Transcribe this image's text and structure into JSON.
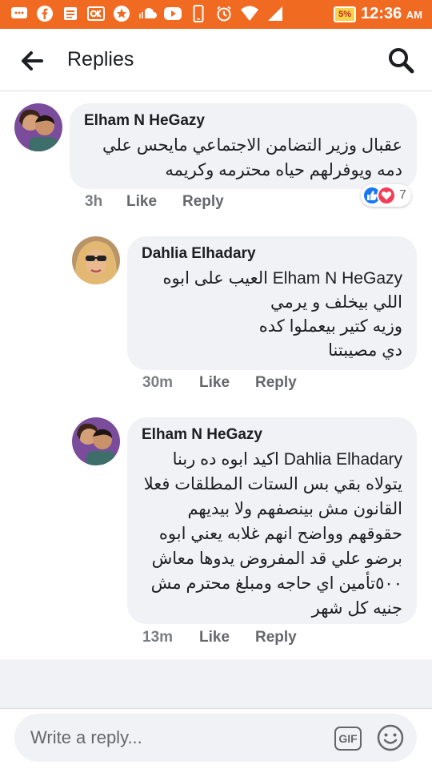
{
  "status_bar": {
    "battery": "5%",
    "time": "12:36",
    "am_pm": "AM"
  },
  "header": {
    "title": "Replies"
  },
  "comments": [
    {
      "author": "Elham N HeGazy",
      "lines": [
        "عقبال وزير التضامن الاجتماعي مايحس علي",
        "دمه ويوفرلهم حياه محترمه وكريمه"
      ],
      "time": "3h",
      "like": "Like",
      "reply": "Reply",
      "reaction_count": "7"
    },
    {
      "author": "Dahlia Elhadary",
      "lines": [
        "Elham N HeGazy العيب على ابوه",
        "اللي بيخلف و يرمي",
        "وزيه كتير بيعملوا كده",
        "دي مصيبتنا"
      ],
      "time": "30m",
      "like": "Like",
      "reply": "Reply"
    },
    {
      "author": "Elham N HeGazy",
      "lines": [
        "Dahlia Elhadary اكيد ابوه ده ربنا",
        "يتولاه بقي بس الستات المطلقات فعلا",
        "القانون مش بينصفهم ولا بيديهم",
        "حقوقهم وواضح انهم غلابه يعني ابوه",
        "برضو علي قد المفروض يدوها معاش",
        "٥٠٠تأمين اي حاجه ومبلغ محترم مش",
        "جنيه كل شهر"
      ],
      "time": "13m",
      "like": "Like",
      "reply": "Reply"
    }
  ],
  "composer": {
    "placeholder": "Write a reply...",
    "gif_label": "GIF"
  },
  "colors": {
    "status_bar": "#f06a22",
    "bubble": "#f0f2f5",
    "like_blue": "#1877f2",
    "love_red": "#f33e58"
  }
}
